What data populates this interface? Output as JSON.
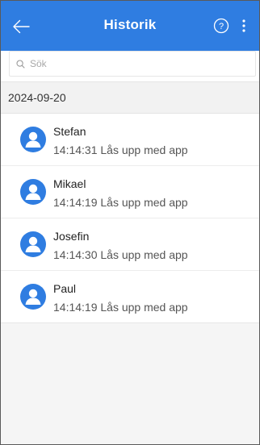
{
  "header": {
    "title": "Historik",
    "back_icon": "arrow-left-icon",
    "help_icon": "question-circle-icon",
    "menu_icon": "more-vertical-icon",
    "background_color": "#2f7de1"
  },
  "search": {
    "placeholder": "Sök",
    "value": "",
    "icon": "search-icon"
  },
  "history": {
    "date": "2024-09-20",
    "entries": [
      {
        "name": "Stefan",
        "time": "14:14:31",
        "action": "Lås upp med app",
        "detail": "14:14:31 Lås upp med app",
        "avatar_icon": "user-avatar-icon"
      },
      {
        "name": "Mikael",
        "time": "14:14:19",
        "action": "Lås upp med app",
        "detail": "14:14:19 Lås upp med app",
        "avatar_icon": "user-avatar-icon"
      },
      {
        "name": "Josefin",
        "time": "14:14:30",
        "action": "Lås upp med app",
        "detail": "14:14:30 Lås upp med app",
        "avatar_icon": "user-avatar-icon"
      },
      {
        "name": "Paul",
        "time": "14:14:19",
        "action": "Lås upp med app",
        "detail": "14:14:19 Lås upp med app",
        "avatar_icon": "user-avatar-icon"
      }
    ]
  }
}
